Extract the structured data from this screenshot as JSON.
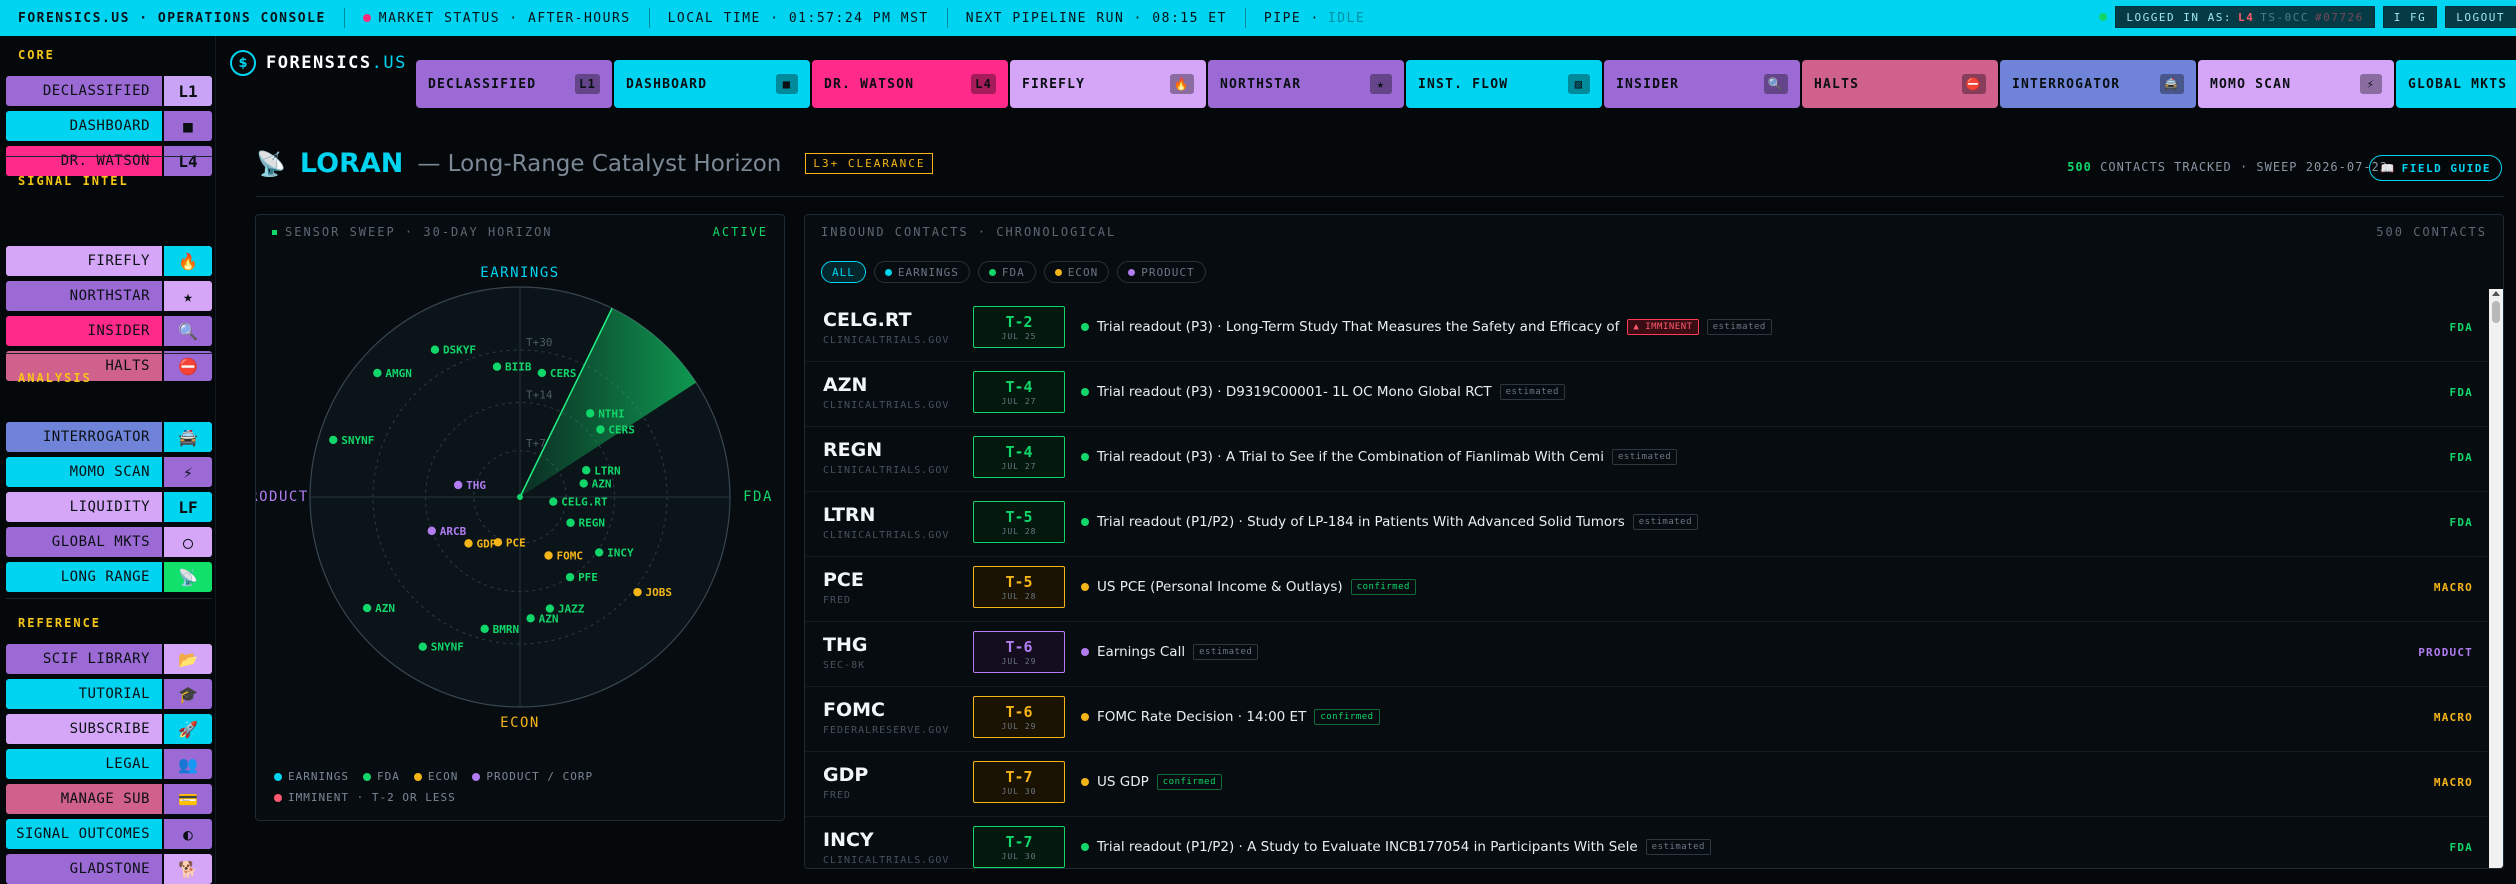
{
  "topbar": {
    "brand": "FORENSICS.US · OPERATIONS CONSOLE",
    "market": "MARKET STATUS · AFTER-HOURS",
    "local_time": "LOCAL TIME · 01:57:24 PM MST",
    "next_run": "NEXT PIPELINE RUN · 08:15 ET",
    "pipe_label": "PIPE ·",
    "pipe_value": "IDLE",
    "login_label": "LOGGED IN AS:",
    "login_level": "L4",
    "login_user": "TS-0CC",
    "login_id": "#07726",
    "fg": "I FG",
    "logout": "LOGOUT"
  },
  "sidebar": {
    "sections": [
      {
        "title": "CORE",
        "items": [
          {
            "label": "DECLASSIFIED",
            "icon": "L1",
            "icon_name": "level-1-badge",
            "color": "#9b6ad4",
            "icolor": "#c9a3f5"
          },
          {
            "label": "DASHBOARD",
            "icon": "■",
            "icon_name": "square-icon",
            "color": "#00d4f0",
            "icolor": "#9b6ad4"
          },
          {
            "label": "DR. WATSON",
            "icon": "L4",
            "icon_name": "level-4-badge",
            "color": "#ff2a8a",
            "icolor": "#9b6ad4"
          }
        ]
      },
      {
        "title": "SIGNAL INTEL",
        "items": [
          {
            "label": "FIREFLY",
            "icon": "🔥",
            "icon_name": "flame-icon",
            "color": "#d5a6f7",
            "icolor": "#00d4f0"
          },
          {
            "label": "NORTHSTAR",
            "icon": "★",
            "icon_name": "star-icon",
            "color": "#9b6ad4",
            "icolor": "#d5a6f7"
          },
          {
            "label": "INSIDER",
            "icon": "🔍",
            "icon_name": "magnifier-icon",
            "color": "#ff2a8a",
            "icolor": "#9b6ad4"
          },
          {
            "label": "HALTS",
            "icon": "⛔",
            "icon_name": "no-entry-icon",
            "color": "#d0608c",
            "icolor": "#9b6ad4"
          }
        ]
      },
      {
        "title": "ANALYSIS",
        "items": [
          {
            "label": "INTERROGATOR",
            "icon": "🚔",
            "icon_name": "police-car-icon",
            "color": "#6f84d8",
            "icolor": "#00d4f0"
          },
          {
            "label": "MOMO SCAN",
            "icon": "⚡",
            "icon_name": "lightning-icon",
            "color": "#00d4f0",
            "icolor": "#9b6ad4"
          },
          {
            "label": "LIQUIDITY",
            "icon": "LF",
            "icon_name": "liquidity-badge",
            "color": "#d5a6f7",
            "icolor": "#00d4f0"
          },
          {
            "label": "GLOBAL MKTS",
            "icon": "◯",
            "icon_name": "globe-icon",
            "color": "#9b6ad4",
            "icolor": "#d5a6f7"
          },
          {
            "label": "LONG RANGE",
            "icon": "📡",
            "icon_name": "satellite-dish-icon",
            "color": "#00d4f0",
            "icolor": "#11e06a"
          }
        ]
      },
      {
        "title": "REFERENCE",
        "items": [
          {
            "label": "SCIF LIBRARY",
            "icon": "📂",
            "icon_name": "folder-icon",
            "color": "#9b6ad4",
            "icolor": "#d5a6f7"
          },
          {
            "label": "TUTORIAL",
            "icon": "🎓",
            "icon_name": "graduation-cap-icon",
            "color": "#00d4f0",
            "icolor": "#9b6ad4"
          },
          {
            "label": "SUBSCRIBE",
            "icon": "🚀",
            "icon_name": "rocket-icon",
            "color": "#d5a6f7",
            "icolor": "#00d4f0"
          },
          {
            "label": "LEGAL",
            "icon": "👥",
            "icon_name": "people-icon",
            "color": "#00d4f0",
            "icolor": "#9b6ad4"
          },
          {
            "label": "MANAGE SUB",
            "icon": "💳",
            "icon_name": "credit-card-icon",
            "color": "#d0608c",
            "icolor": "#9b6ad4"
          },
          {
            "label": "SIGNAL OUTCOMES",
            "icon": "◐",
            "icon_name": "half-circle-icon",
            "color": "#00d4f0",
            "icolor": "#9b6ad4"
          },
          {
            "label": "GLADSTONE",
            "icon": "🐕",
            "icon_name": "dog-icon",
            "color": "#9b6ad4",
            "icolor": "#d5a6f7"
          }
        ]
      }
    ]
  },
  "brand": {
    "name": "FORENSICS",
    "suffix": ".US"
  },
  "nav_tabs": [
    {
      "label": "DECLASSIFIED",
      "icon": "L1",
      "icon_name": "level-1-badge",
      "color": "#9b6ad4"
    },
    {
      "label": "DASHBOARD",
      "icon": "■",
      "icon_name": "square-icon",
      "color": "#00d4f0"
    },
    {
      "label": "DR. WATSON",
      "icon": "L4",
      "icon_name": "level-4-badge",
      "color": "#ff2a8a"
    },
    {
      "label": "FIREFLY",
      "icon": "🔥",
      "icon_name": "flame-icon",
      "color": "#d5a6f7"
    },
    {
      "label": "NORTHSTAR",
      "icon": "★",
      "icon_name": "star-icon",
      "color": "#9b6ad4"
    },
    {
      "label": "INST. FLOW",
      "icon": "▨",
      "icon_name": "chart-icon",
      "color": "#00d4f0"
    },
    {
      "label": "INSIDER",
      "icon": "🔍",
      "icon_name": "magnifier-icon",
      "color": "#9b6ad4"
    },
    {
      "label": "HALTS",
      "icon": "⛔",
      "icon_name": "no-entry-icon",
      "color": "#d0608c"
    },
    {
      "label": "INTERROGATOR",
      "icon": "🚔",
      "icon_name": "police-car-icon",
      "color": "#6f84d8"
    },
    {
      "label": "MOMO SCAN",
      "icon": "⚡",
      "icon_name": "lightning-icon",
      "color": "#d5a6f7"
    },
    {
      "label": "GLOBAL MKTS",
      "icon": "",
      "icon_name": "globe-icon",
      "color": "#00d4f0"
    }
  ],
  "page": {
    "title": "LORAN",
    "subtitle": "— Long-Range Catalyst Horizon",
    "clearance": "L3+ CLEARANCE",
    "contacts_count": "500",
    "meta_rest": "CONTACTS TRACKED · SWEEP 2026-07-23",
    "field_guide": "FIELD GUIDE"
  },
  "radar": {
    "header": "SENSOR SWEEP · 30-DAY HORIZON",
    "status": "ACTIVE",
    "axes": {
      "top": "EARNINGS",
      "right": "FDA",
      "bottom": "ECON",
      "left": "PRODUCT"
    },
    "rings": [
      "T+7",
      "T+14",
      "T+30"
    ],
    "legend": [
      {
        "label": "EARNINGS",
        "color": "#00d4f0"
      },
      {
        "label": "FDA",
        "color": "#11d66a"
      },
      {
        "label": "ECON",
        "color": "#f5b518"
      },
      {
        "label": "PRODUCT / CORP",
        "color": "#b07cf0"
      }
    ],
    "legend2": {
      "label": "IMMINENT · T-2 OR LESS",
      "color": "#ff5a6e"
    },
    "contacts": [
      {
        "label": "SNYNF",
        "type": "fda",
        "ang": 287,
        "r": 0.93
      },
      {
        "label": "AMGN",
        "type": "fda",
        "ang": 311,
        "r": 0.9
      },
      {
        "label": "DSKYF",
        "type": "fda",
        "ang": 330,
        "r": 0.81
      },
      {
        "label": "BIIB",
        "type": "fda",
        "ang": 350,
        "r": 0.63
      },
      {
        "label": "CERS",
        "type": "fda",
        "ang": 10,
        "r": 0.6
      },
      {
        "label": "NTHI",
        "type": "fda",
        "ang": 40,
        "r": 0.52
      },
      {
        "label": "CERS",
        "type": "fda",
        "ang": 50,
        "r": 0.5
      },
      {
        "label": "LTRN",
        "type": "fda",
        "ang": 68,
        "r": 0.34
      },
      {
        "label": "AZN",
        "type": "fda",
        "ang": 78,
        "r": 0.31
      },
      {
        "label": "CELG.RT",
        "type": "fda",
        "ang": 98,
        "r": 0.16
      },
      {
        "label": "REGN",
        "type": "fda",
        "ang": 117,
        "r": 0.27
      },
      {
        "label": "INCY",
        "type": "fda",
        "ang": 125,
        "r": 0.46
      },
      {
        "label": "PFE",
        "type": "fda",
        "ang": 148,
        "r": 0.45
      },
      {
        "label": "JAZZ",
        "type": "fda",
        "ang": 165,
        "r": 0.55
      },
      {
        "label": "AZN",
        "type": "fda",
        "ang": 175,
        "r": 0.58
      },
      {
        "label": "BMRN",
        "type": "fda",
        "ang": 195,
        "r": 0.65
      },
      {
        "label": "SNYNF",
        "type": "fda",
        "ang": 213,
        "r": 0.85
      },
      {
        "label": "AZN",
        "type": "fda",
        "ang": 234,
        "r": 0.9
      },
      {
        "label": "THG",
        "type": "product",
        "ang": 281,
        "r": 0.3
      },
      {
        "label": "ARCB",
        "type": "product",
        "ang": 249,
        "r": 0.45
      },
      {
        "label": "PCE",
        "type": "econ",
        "ang": 206,
        "r": 0.24
      },
      {
        "label": "GDP",
        "type": "econ",
        "ang": 228,
        "r": 0.33
      },
      {
        "label": "FOMC",
        "type": "econ",
        "ang": 154,
        "r": 0.31
      },
      {
        "label": "JOBS",
        "type": "econ",
        "ang": 129,
        "r": 0.72
      }
    ]
  },
  "contacts_panel": {
    "header": "INBOUND CONTACTS · CHRONOLOGICAL",
    "count": "500 CONTACTS",
    "filters": [
      {
        "label": "ALL",
        "color": "",
        "active": true
      },
      {
        "label": "EARNINGS",
        "color": "#00d4f0",
        "active": false
      },
      {
        "label": "FDA",
        "color": "#11d66a",
        "active": false
      },
      {
        "label": "ECON",
        "color": "#f5b518",
        "active": false
      },
      {
        "label": "PRODUCT",
        "color": "#b07cf0",
        "active": false
      }
    ],
    "rows": [
      {
        "ticker": "CELG.RT",
        "source": "CLINICALTRIALS.GOV",
        "t": "T-2",
        "date": "JUL 25",
        "color": "#11d66a",
        "text": "Trial readout (P3) · Long-Term Study That Measures the Safety and Efficacy of",
        "badges": [
          {
            "text": "▲ IMMINENT",
            "kind": "imm"
          },
          {
            "text": "estimated",
            "kind": "est"
          }
        ],
        "category": "FDA"
      },
      {
        "ticker": "AZN",
        "source": "CLINICALTRIALS.GOV",
        "t": "T-4",
        "date": "JUL 27",
        "color": "#11d66a",
        "text": "Trial readout (P3) · D9319C00001- 1L OC Mono Global RCT",
        "badges": [
          {
            "text": "estimated",
            "kind": "est"
          }
        ],
        "category": "FDA"
      },
      {
        "ticker": "REGN",
        "source": "CLINICALTRIALS.GOV",
        "t": "T-4",
        "date": "JUL 27",
        "color": "#11d66a",
        "text": "Trial readout (P3) · A Trial to See if the Combination of Fianlimab With Cemi",
        "badges": [
          {
            "text": "estimated",
            "kind": "est"
          }
        ],
        "category": "FDA"
      },
      {
        "ticker": "LTRN",
        "source": "CLINICALTRIALS.GOV",
        "t": "T-5",
        "date": "JUL 28",
        "color": "#11d66a",
        "text": "Trial readout (P1/P2) · Study of LP-184 in Patients With Advanced Solid Tumors",
        "badges": [
          {
            "text": "estimated",
            "kind": "est"
          }
        ],
        "category": "FDA"
      },
      {
        "ticker": "PCE",
        "source": "FRED",
        "t": "T-5",
        "date": "JUL 28",
        "color": "#f5b518",
        "text": "US PCE (Personal Income & Outlays)",
        "badges": [
          {
            "text": "confirmed",
            "kind": "conf"
          }
        ],
        "category": "MACRO"
      },
      {
        "ticker": "THG",
        "source": "SEC-8K",
        "t": "T-6",
        "date": "JUL 29",
        "color": "#b07cf0",
        "text": "Earnings Call",
        "badges": [
          {
            "text": "estimated",
            "kind": "est"
          }
        ],
        "category": "PRODUCT"
      },
      {
        "ticker": "FOMC",
        "source": "FEDERALRESERVE.GOV",
        "t": "T-6",
        "date": "JUL 29",
        "color": "#f5b518",
        "text": "FOMC Rate Decision · 14:00 ET",
        "badges": [
          {
            "text": "confirmed",
            "kind": "conf"
          }
        ],
        "category": "MACRO"
      },
      {
        "ticker": "GDP",
        "source": "FRED",
        "t": "T-7",
        "date": "JUL 30",
        "color": "#f5b518",
        "text": "US GDP",
        "badges": [
          {
            "text": "confirmed",
            "kind": "conf"
          }
        ],
        "category": "MACRO"
      },
      {
        "ticker": "INCY",
        "source": "CLINICALTRIALS.GOV",
        "t": "T-7",
        "date": "JUL 30",
        "color": "#11d66a",
        "text": "Trial readout (P1/P2) · A Study to Evaluate INCB177054 in Participants With Sele",
        "badges": [
          {
            "text": "estimated",
            "kind": "est"
          }
        ],
        "category": "FDA"
      }
    ]
  }
}
